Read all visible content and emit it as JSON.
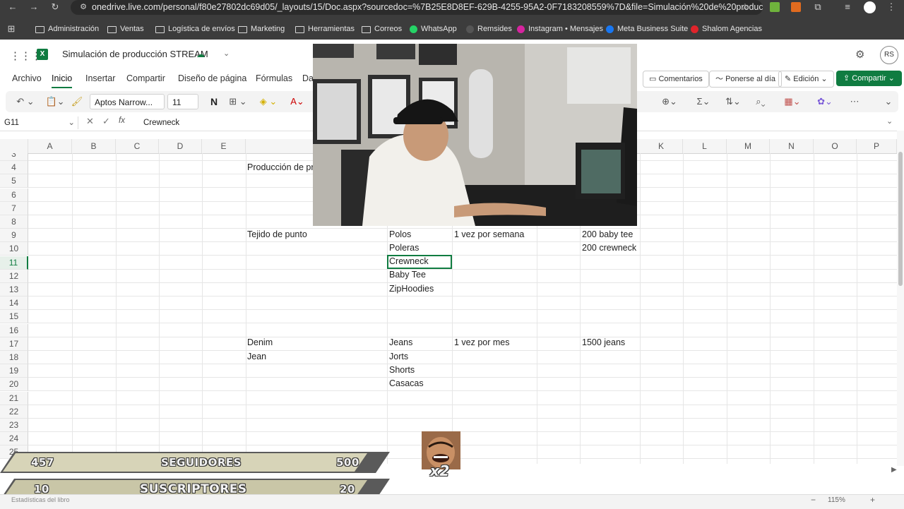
{
  "browser": {
    "url": "onedrive.live.com/personal/f80e27802dc69d05/_layouts/15/Doc.aspx?sourcedoc=%7B25E8D8EF-629B-4255-95A2-0F7183208559%7D&file=Simulación%20de%20producción...",
    "profile_initial": "RS",
    "bookmarks": [
      "Administración",
      "Ventas",
      "Logística de envíos",
      "Marketing",
      "Herramientas",
      "Correos",
      "WhatsApp",
      "Remsides",
      "Instagram • Mensajes",
      "Meta Business Suite",
      "Shalom Agencias"
    ]
  },
  "app": {
    "file_title": "Simulación de producción STREAM",
    "avatar_initials": "RS",
    "tabs": [
      "Archivo",
      "Inicio",
      "Insertar",
      "Compartir",
      "Diseño de página",
      "Fórmulas",
      "Da"
    ],
    "active_tab": "Inicio",
    "right_buttons": {
      "comments": "Comentarios",
      "catch_up": "Ponerse al día",
      "edit_mode": "Edición",
      "share": "Compartir"
    },
    "font_name": "Aptos Narrow...",
    "font_size": "11",
    "bold_glyph": "N",
    "name_box": "G11",
    "formula_value": "Crewneck",
    "fx_label": "fx"
  },
  "sheet": {
    "columns": [
      "A",
      "B",
      "C",
      "D",
      "E",
      "",
      "",
      "",
      "",
      "",
      "",
      "K",
      "L",
      "M",
      "N",
      "O",
      "P"
    ],
    "rows": [
      "3",
      "4",
      "5",
      "6",
      "7",
      "8",
      "9",
      "10",
      "11",
      "12",
      "13",
      "14",
      "15",
      "16",
      "17",
      "18",
      "19",
      "20",
      "21",
      "22",
      "23",
      "24",
      "25"
    ],
    "selected_row": "11",
    "cells": {
      "r4_f": "Producción de pr",
      "r9_f": "Tejido de punto",
      "r9_g": "Polos",
      "r9_h": "1 vez por semana",
      "r9_j": "200 baby tee",
      "r10_g": "Poleras",
      "r10_j": "200 crewneck",
      "r11_g": "Crewneck",
      "r12_g": "Baby Tee",
      "r13_g": "ZipHoodies",
      "r17_f": "Denim",
      "r17_g": "Jeans",
      "r17_h": "1 vez por mes",
      "r17_j": "1500 jeans",
      "r18_f": "Jean",
      "r18_g": "Jorts",
      "r19_g": "Shorts",
      "r20_g": "Casacas"
    }
  },
  "overlay": {
    "followers": {
      "current": "457",
      "label": "SEGUIDORES",
      "goal": "500"
    },
    "subscribers": {
      "current": "10",
      "label": "SUSCRIPTORES",
      "goal": "20"
    },
    "multiplier": "x2"
  },
  "status": {
    "left_text": "Estadísticas del libro",
    "zoom": "115%"
  },
  "colors": {
    "excel_green": "#107c41",
    "chrome_dark": "#3c3c3c"
  }
}
